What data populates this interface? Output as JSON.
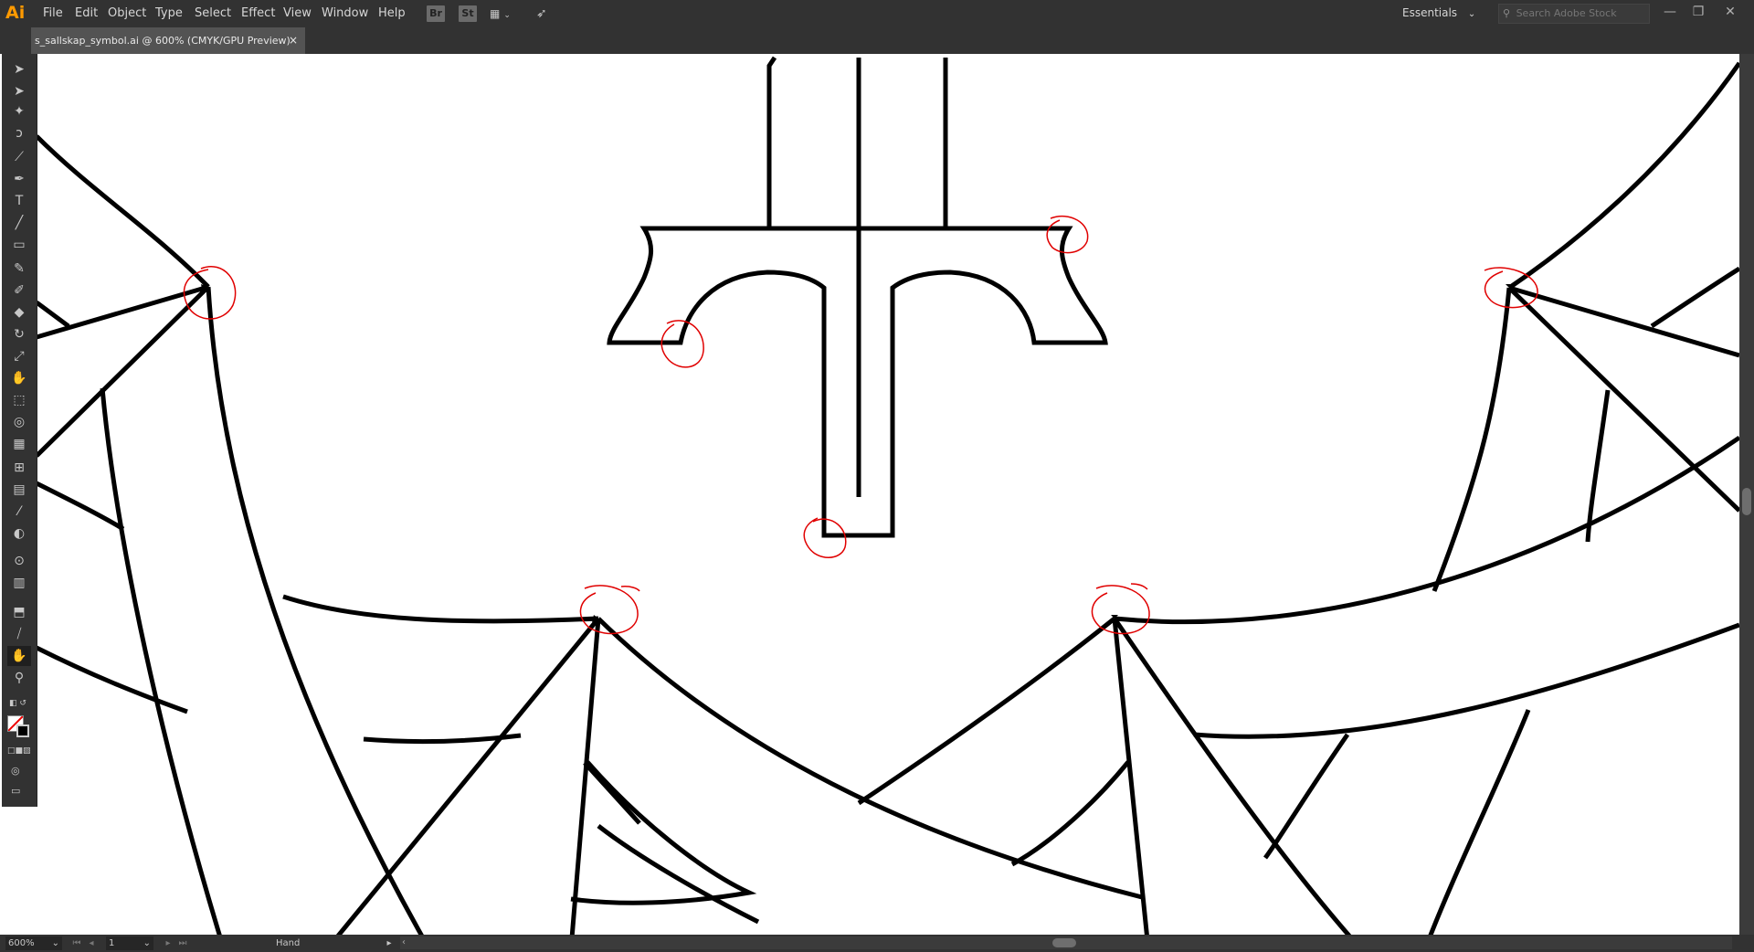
{
  "app": {
    "logo": "Ai",
    "accent": "#ff9a00"
  },
  "menu": {
    "items": [
      "File",
      "Edit",
      "Object",
      "Type",
      "Select",
      "Effect",
      "View",
      "Window",
      "Help"
    ]
  },
  "app_bar": {
    "bridge": "Br",
    "stock_app": "St",
    "workspace": "Essentials",
    "search_placeholder": "Search Adobe Stock"
  },
  "window_controls": {
    "minimize": "—",
    "restore": "❐",
    "close": "✕"
  },
  "tab": {
    "title": "s_sallskap_symbol.ai @ 600% (CMYK/GPU Preview)",
    "close": "×"
  },
  "tools": [
    {
      "name": "selection-tool",
      "glyph": "➤"
    },
    {
      "name": "direct-selection-tool",
      "glyph": "➤"
    },
    {
      "name": "magic-wand-tool",
      "glyph": "✦"
    },
    {
      "name": "lasso-tool",
      "glyph": "ↄ"
    },
    {
      "name": "anchor-tool",
      "glyph": "⟋"
    },
    {
      "name": "pen-tool",
      "glyph": "✒"
    },
    {
      "name": "type-tool",
      "glyph": "T"
    },
    {
      "name": "line-tool",
      "glyph": "╱"
    },
    {
      "name": "rectangle-tool",
      "glyph": "▭"
    },
    {
      "name": "paintbrush-tool",
      "glyph": "✎"
    },
    {
      "name": "shaper-tool",
      "glyph": "✐"
    },
    {
      "name": "eraser-tool",
      "glyph": "◆"
    },
    {
      "name": "rotate-tool",
      "glyph": "↻"
    },
    {
      "name": "scale-tool",
      "glyph": "⤢"
    },
    {
      "name": "warp-tool",
      "glyph": "✋"
    },
    {
      "name": "free-transform-tool",
      "glyph": "⬚"
    },
    {
      "name": "shape-builder-tool",
      "glyph": "◎"
    },
    {
      "name": "perspective-grid-tool",
      "glyph": "▦"
    },
    {
      "name": "mesh-tool",
      "glyph": "⊞"
    },
    {
      "name": "gradient-tool",
      "glyph": "▤"
    },
    {
      "name": "eyedropper-tool",
      "glyph": "⁄"
    },
    {
      "name": "blend-tool",
      "glyph": "◐"
    },
    {
      "name": "symbol-sprayer-tool",
      "glyph": "⊙"
    },
    {
      "name": "column-graph-tool",
      "glyph": "▥"
    },
    {
      "name": "artboard-tool",
      "glyph": "⬒"
    },
    {
      "name": "slice-tool",
      "glyph": "⧸"
    },
    {
      "name": "hand-tool",
      "glyph": "✋"
    },
    {
      "name": "zoom-tool",
      "glyph": "⚲"
    }
  ],
  "status": {
    "zoom": "600%",
    "page": "1",
    "tool": "Hand"
  }
}
